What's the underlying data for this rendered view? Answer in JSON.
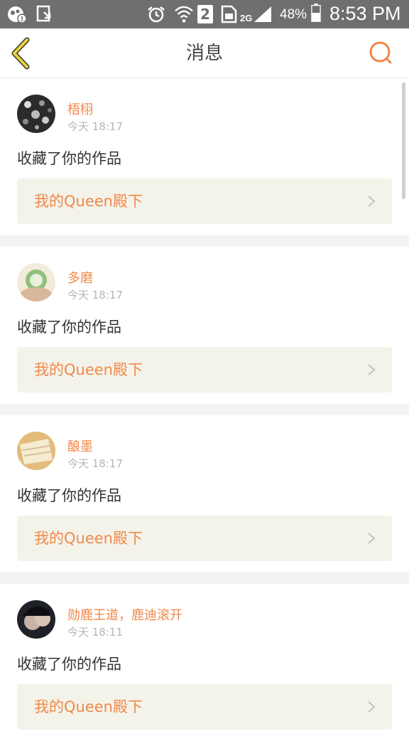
{
  "status_bar": {
    "network": "2G",
    "sim": "2",
    "battery": "48%",
    "time": "8:53 PM"
  },
  "nav": {
    "title": "消息"
  },
  "notifications": [
    {
      "user": "梧栩",
      "time": "今天 18:17",
      "action": "收藏了你的作品",
      "work": "我的Queen殿下"
    },
    {
      "user": "多磨",
      "time": "今天 18:17",
      "action": "收藏了你的作品",
      "work": "我的Queen殿下"
    },
    {
      "user": "酿墨",
      "time": "今天 18:17",
      "action": "收藏了你的作品",
      "work": "我的Queen殿下"
    },
    {
      "user": "勋鹿王道，鹿迪滚开",
      "time": "今天 18:11",
      "action": "收藏了你的作品",
      "work": "我的Queen殿下"
    }
  ],
  "colors": {
    "accent": "#f0884a",
    "status_bar_bg": "#6f6f6f",
    "link_bg": "#f4f3ea",
    "back_arrow": "#e8d23c"
  }
}
